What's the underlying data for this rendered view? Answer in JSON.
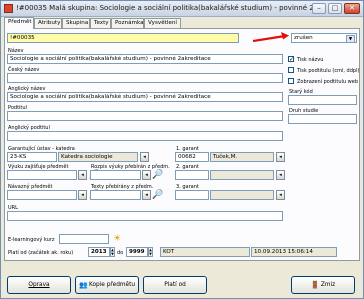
{
  "window": {
    "title": "!#00035 Malá skupina: Sociologie a sociální politika(bakalářské studium) - povinné 2akredit..."
  },
  "tabs": [
    "Předmět",
    "Atributy",
    "Skupina",
    "Texty",
    "Poznámka",
    "Vysvětlení"
  ],
  "form": {
    "code": "!#00035",
    "status_value": "zrušen",
    "labels": {
      "nazev": "Název",
      "cesky_nazev": "Český název",
      "anglicky_nazev": "Anglický název",
      "podtitul": "Podtitul",
      "anglicky_podtitul": "Anglický podtitul",
      "stary_kod": "Starý kód",
      "druh_studie": "Druh studie",
      "garantujici": "Garantující ústav - katedra",
      "garant1": "1. garant",
      "vyuku_zajistuje": "Výuku zajišťuje předmět",
      "rozpis_vyuky": "Rozpis výuky přebírán z předm.",
      "garant2": "2. garant",
      "navazny": "Návazný předmět",
      "texty_prebirany": "Texty přebírány z předm.",
      "garant3": "3. garant",
      "url": "URL",
      "elearning": "E-learningový kurz",
      "plati_od": "Platí od (začátek ak. roku)",
      "do": "do"
    },
    "nazev_value": "Sociologie a sociální politika(bakalářské studium) - povinné 2akreditace",
    "anglicky_nazev_value": "Sociologie a sociální politika(bakalářské studium) - povinné 2akreditace",
    "ustav_code": "23-KS",
    "ustav_name": "Katedra sociologie",
    "garant1_code": "00682",
    "garant1_name": "Tuček,M.",
    "plati_od_value": "2013",
    "do_value": "9999",
    "user_code": "KOT",
    "timestamp": "10.09.2013 15:06:14",
    "checkboxes": [
      {
        "label": "Tisk názvu",
        "checked": true
      },
      {
        "label": "Tisk podtitulu (cml, ddpl)",
        "checked": false
      },
      {
        "label": "Zobrazení podtitulu web",
        "checked": false
      }
    ]
  },
  "buttons": {
    "oprava": "Oprava",
    "kopie": "Kopie předmětu",
    "plati_od": "Platí od",
    "zmiz": "Zmiz"
  },
  "colors": {
    "arrow": "#e01010",
    "title_accent": "#fffba8",
    "window_border": "#6f8fb5"
  },
  "icons": [
    "app-icon",
    "select-icon",
    "person-search-icon",
    "sun-icon",
    "people-icon",
    "exit-icon"
  ]
}
